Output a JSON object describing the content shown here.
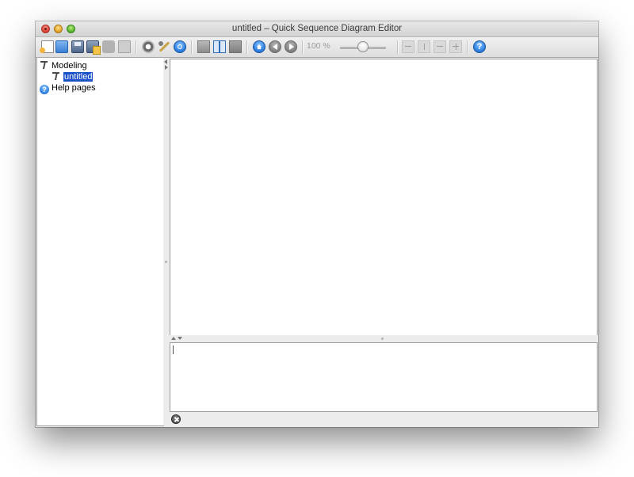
{
  "window": {
    "title": "untitled – Quick Sequence Diagram Editor"
  },
  "toolbar": {
    "zoom_label": "100 %",
    "help_glyph": "?",
    "icons": [
      "new-file-icon",
      "open-folder-icon",
      "save-icon",
      "save-as-icon",
      "export-icon",
      "print-icon",
      "zoom-magnifier-icon",
      "wrench-icon",
      "reload-icon",
      "layout-top-bottom-icon",
      "layout-left-right-icon",
      "layout-fullscreen-icon",
      "home-icon",
      "back-icon",
      "forward-icon",
      "zoom-slider",
      "fit-width-icon",
      "fit-height-icon",
      "fit-horizontal-icon",
      "fit-all-icon",
      "help-icon"
    ]
  },
  "tree": {
    "items": [
      {
        "label": "Modeling",
        "icon": "tool-icon"
      },
      {
        "label": "untitled",
        "icon": "tool-icon",
        "selected": true
      },
      {
        "label": "Help pages",
        "icon": "help-icon"
      }
    ]
  },
  "colors": {
    "selection": "#1c52c9",
    "accent": "#2d7fe0"
  }
}
